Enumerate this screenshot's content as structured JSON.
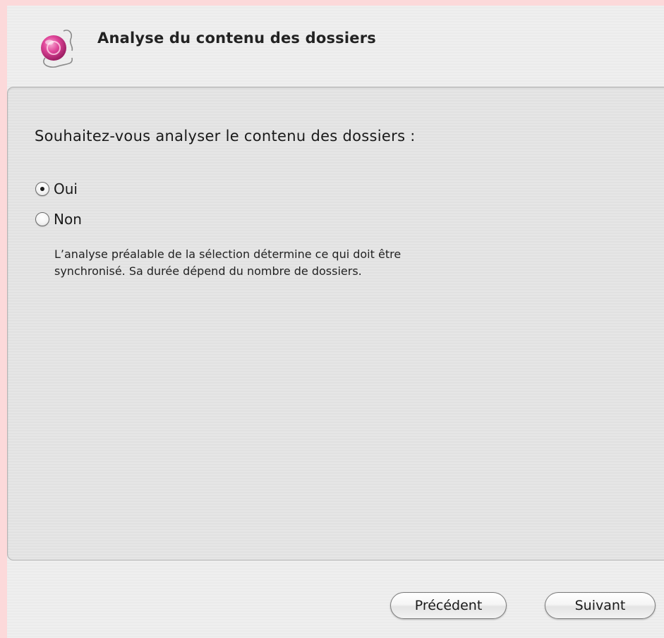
{
  "header": {
    "title": "Analyse du contenu des dossiers",
    "icon": "sync-assistant-icon"
  },
  "content": {
    "question": "Souhaitez-vous analyser le contenu des dossiers :",
    "options": [
      {
        "label": "Oui",
        "selected": true
      },
      {
        "label": "Non",
        "selected": false
      }
    ],
    "description_lines": [
      "L’analyse préalable de la sélection détermine ce qui doit être",
      "synchronisé. Sa durée dépend du nombre de dossiers."
    ]
  },
  "footer": {
    "previous_label": "Précédent",
    "next_label": "Suivant"
  },
  "colors": {
    "background_pink": "#fcd9da",
    "window_bg": "#efefef",
    "icon_pink": "#e0469a"
  }
}
